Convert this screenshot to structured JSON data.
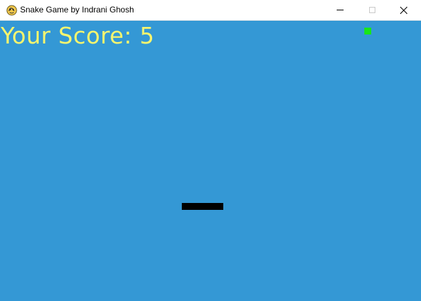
{
  "window": {
    "title": "Snake Game by Indrani Ghosh",
    "icon": "python-snake-icon"
  },
  "controls": {
    "minimize_icon": "minimize-icon",
    "maximize_icon": "maximize-icon",
    "close_icon": "close-icon"
  },
  "game": {
    "background_color": "#3498d5",
    "score_label": "Your Score: 5",
    "score_value": 5,
    "score_color": "#f7f56e",
    "food_color": "#19e619",
    "snake_color": "#000000",
    "snake_segments": 6
  }
}
